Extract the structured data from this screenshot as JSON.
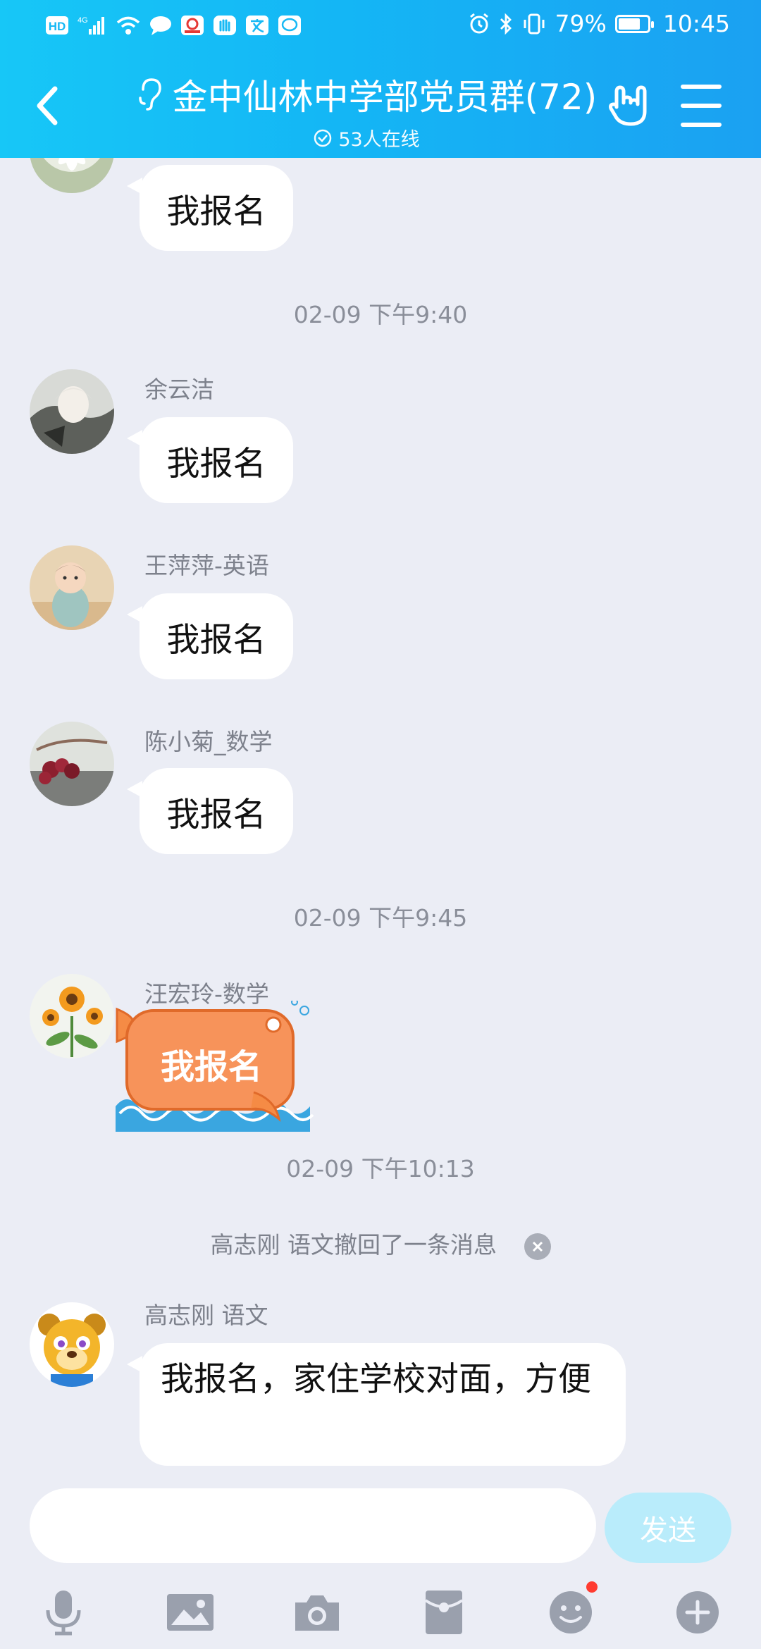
{
  "status_bar": {
    "left_badges": [
      "HD",
      "4G"
    ],
    "battery": "79%",
    "battery_level": 0.79,
    "time": "10:45"
  },
  "header": {
    "title": "金中仙林中学部党员群(72)",
    "online": "53人在线"
  },
  "messages": {
    "m0": {
      "text": "我报名"
    },
    "ts1": "02-09 下午9:40",
    "m1": {
      "sender": "余云洁",
      "text": "我报名"
    },
    "m2": {
      "sender": "王萍萍-英语",
      "text": "我报名"
    },
    "m3": {
      "sender": "陈小菊_数学",
      "text": "我报名"
    },
    "ts2": "02-09 下午9:45",
    "m4": {
      "sender": "汪宏玲-数学",
      "sticker_text": "我报名"
    },
    "ts3": "02-09 下午10:13",
    "recall": "高志刚 语文撤回了一条消息",
    "m5": {
      "sender": "高志刚 语文",
      "text": "我报名，家住学校对面，方便"
    }
  },
  "input": {
    "value": "",
    "placeholder": "",
    "send_label": "发送"
  },
  "toolbar_icons": [
    "mic-icon",
    "image-icon",
    "camera-icon",
    "red-packet-icon",
    "emoji-icon",
    "plus-icon"
  ],
  "colors": {
    "header": "#17c7f7",
    "background": "#ebedf5",
    "send_button": "#b9ecfb"
  }
}
